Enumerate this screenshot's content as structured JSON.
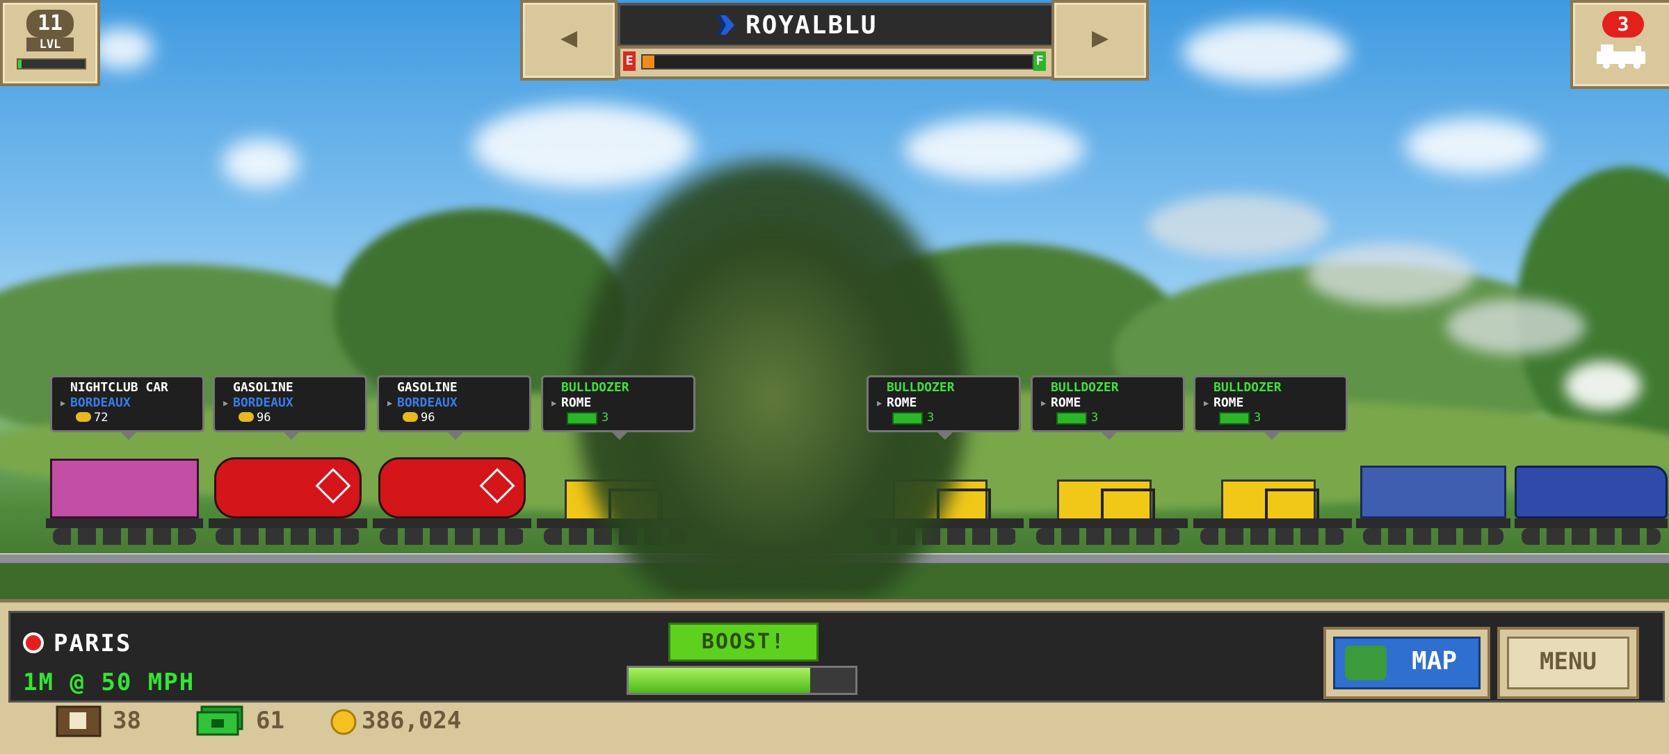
{
  "player": {
    "level": "11",
    "level_label": "LVL",
    "xp_fraction": 0.05
  },
  "trains_badge": {
    "count": "3"
  },
  "header": {
    "train_name": "ROYALBLU",
    "fuel_empty_label": "E",
    "fuel_full_label": "F",
    "fuel_fraction": 0.03
  },
  "cars": [
    {
      "cargo": "NIGHTCLUB CAR",
      "destination": "BORDEAUX",
      "value": "72",
      "reward": "coins"
    },
    {
      "cargo": "GASOLINE",
      "destination": "BORDEAUX",
      "value": "96",
      "reward": "coins"
    },
    {
      "cargo": "GASOLINE",
      "destination": "BORDEAUX",
      "value": "96",
      "reward": "coins"
    },
    {
      "cargo": "BULLDOZER",
      "destination": "ROME",
      "value": "3",
      "reward": "cash"
    },
    {
      "cargo": "BULLDOZER",
      "destination": "ROME",
      "value": "3",
      "reward": "cash"
    },
    {
      "cargo": "BULLDOZER",
      "destination": "ROME",
      "value": "3",
      "reward": "cash"
    },
    {
      "cargo": "BULLDOZER",
      "destination": "ROME",
      "value": "3",
      "reward": "cash"
    }
  ],
  "status": {
    "station": "PARIS",
    "speed": "1M @ 50 MPH",
    "boost_label": "BOOST!",
    "boost_fraction": 0.8
  },
  "buttons": {
    "map": "MAP",
    "menu": "MENU"
  },
  "resources": {
    "crates": "38",
    "cash": "61",
    "coins": "386,024"
  },
  "colors": {
    "tank_red": "#d4151a",
    "dozer_yellow": "#f2c818",
    "loco_blue": "#2f4aa8",
    "speed_green": "#32e634"
  }
}
